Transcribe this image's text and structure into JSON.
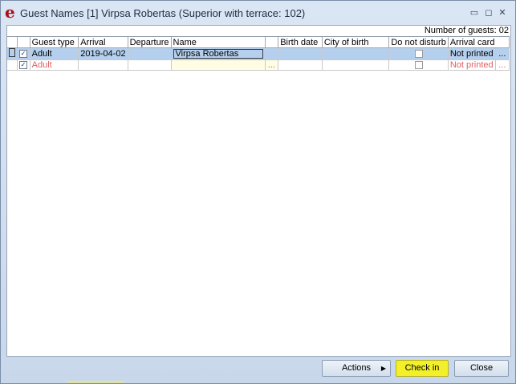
{
  "window": {
    "title": "Guest Names [1] Virpsa Robertas (Superior with terrace: 102)",
    "controls": {
      "minimize": "▭",
      "maximize": "◻",
      "close": "✕"
    }
  },
  "guest_count_label": "Number of guests: 02",
  "columns": [
    "Guest type",
    "Arrival",
    "Departure",
    "Name",
    "Birth date",
    "City of birth",
    "Do not disturb",
    "Arrival card"
  ],
  "rows": [
    {
      "checked": "✓",
      "guest_type": "Adult",
      "arrival": "2019-04-02",
      "departure": "",
      "name": "Virpsa Robertas",
      "name_button": "",
      "birth_date": "",
      "city_of_birth": "",
      "arrival_card": "Not printed",
      "card_button": "..."
    },
    {
      "checked": "✓",
      "guest_type": "Adult",
      "arrival": "",
      "departure": "",
      "name": "",
      "name_button": "...",
      "birth_date": "",
      "city_of_birth": "",
      "arrival_card": "Not printed",
      "card_button": "..."
    }
  ],
  "buttons": {
    "actions": "Actions",
    "actions_arrow": "▶",
    "checkin": "Check in",
    "close": "Close"
  },
  "colors": {
    "accent": "#a8101c",
    "selection": "#b5d0ee",
    "highlight": "#f3f02a",
    "new_row_text": "#e06060"
  }
}
